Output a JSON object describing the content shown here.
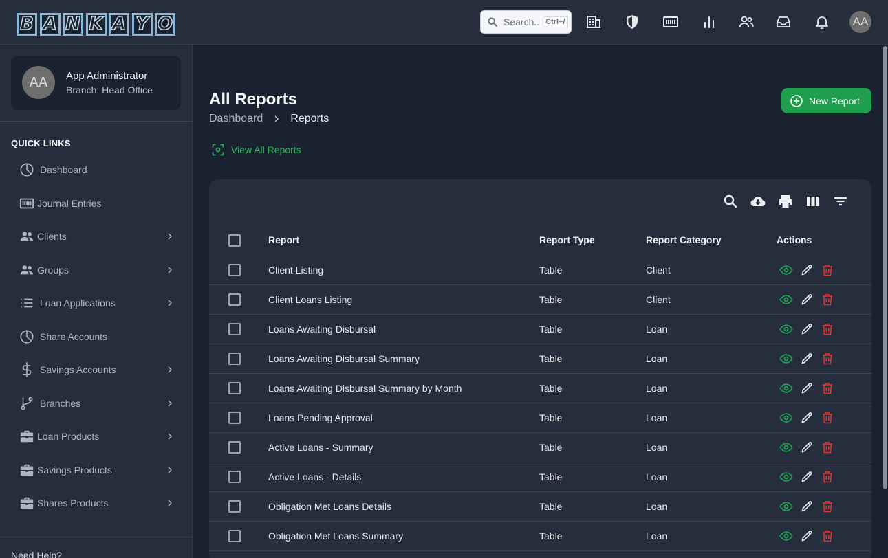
{
  "app": {
    "logo_letters": [
      "B",
      "A",
      "N",
      "K",
      "A",
      "Y",
      "O"
    ],
    "logo_text": "BANKAYO"
  },
  "header": {
    "search_placeholder": "Search..",
    "search_shortcut": "Ctrl+/",
    "icons": [
      "building-icon",
      "shield-icon",
      "ledger-icon",
      "bar-chart-icon",
      "users-icon",
      "inbox-icon",
      "bell-icon"
    ],
    "avatar_initials": "AA"
  },
  "sidebar": {
    "user": {
      "initials": "AA",
      "name": "App Administrator",
      "branch": "Branch: Head Office"
    },
    "section_title": "QUICK LINKS",
    "items": [
      {
        "label": "Dashboard",
        "icon": "pie-chart-icon",
        "has_children": false
      },
      {
        "label": "Journal Entries",
        "icon": "ledger-icon",
        "has_children": false
      },
      {
        "label": "Clients",
        "icon": "users-icon",
        "has_children": true
      },
      {
        "label": "Groups",
        "icon": "users-icon",
        "has_children": true
      },
      {
        "label": "Loan Applications",
        "icon": "list-icon",
        "has_children": true
      },
      {
        "label": "Share Accounts",
        "icon": "pie-chart-icon",
        "has_children": false
      },
      {
        "label": "Savings Accounts",
        "icon": "dollar-icon",
        "has_children": true
      },
      {
        "label": "Branches",
        "icon": "git-branch-icon",
        "has_children": true
      },
      {
        "label": "Loan Products",
        "icon": "briefcase-icon",
        "has_children": true
      },
      {
        "label": "Savings Products",
        "icon": "briefcase-icon",
        "has_children": true
      },
      {
        "label": "Shares Products",
        "icon": "briefcase-icon",
        "has_children": true
      }
    ],
    "help_text": "Need Help?"
  },
  "main": {
    "title": "All Reports",
    "breadcrumb": {
      "parent": "Dashboard",
      "current": "Reports"
    },
    "new_button_label": "New Report",
    "view_all_label": "View All Reports",
    "table": {
      "columns": [
        "Report",
        "Report Type",
        "Report Category",
        "Actions"
      ],
      "rows": [
        {
          "report": "Client Listing",
          "type": "Table",
          "category": "Client"
        },
        {
          "report": "Client Loans Listing",
          "type": "Table",
          "category": "Client"
        },
        {
          "report": "Loans Awaiting Disbursal",
          "type": "Table",
          "category": "Loan"
        },
        {
          "report": "Loans Awaiting Disbursal Summary",
          "type": "Table",
          "category": "Loan"
        },
        {
          "report": "Loans Awaiting Disbursal Summary by Month",
          "type": "Table",
          "category": "Loan"
        },
        {
          "report": "Loans Pending Approval",
          "type": "Table",
          "category": "Loan"
        },
        {
          "report": "Active Loans - Summary",
          "type": "Table",
          "category": "Loan"
        },
        {
          "report": "Active Loans - Details",
          "type": "Table",
          "category": "Loan"
        },
        {
          "report": "Obligation Met Loans Details",
          "type": "Table",
          "category": "Loan"
        },
        {
          "report": "Obligation Met Loans Summary",
          "type": "Table",
          "category": "Loan"
        }
      ]
    }
  },
  "colors": {
    "accent_green": "#1f9f4e",
    "danger_red": "#e0342f",
    "background": "#1a2130",
    "panel": "#262e3d"
  }
}
